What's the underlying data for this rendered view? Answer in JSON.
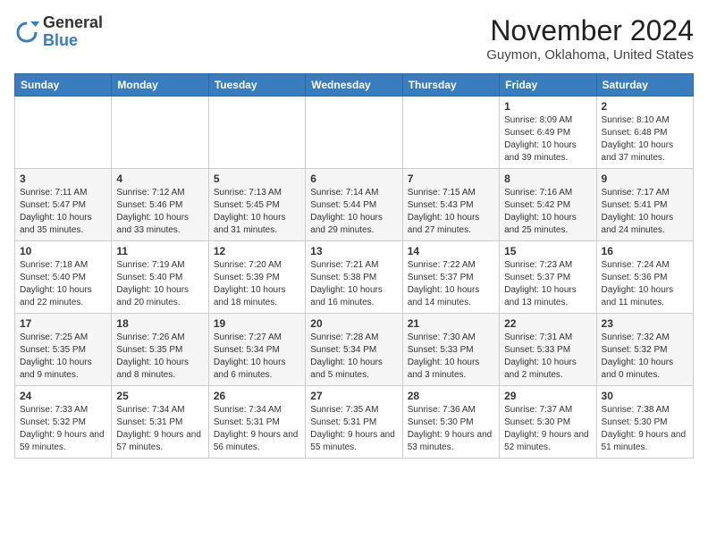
{
  "header": {
    "logo_line1": "General",
    "logo_line2": "Blue",
    "month": "November 2024",
    "location": "Guymon, Oklahoma, United States"
  },
  "weekdays": [
    "Sunday",
    "Monday",
    "Tuesday",
    "Wednesday",
    "Thursday",
    "Friday",
    "Saturday"
  ],
  "weeks": [
    [
      {
        "day": "",
        "info": ""
      },
      {
        "day": "",
        "info": ""
      },
      {
        "day": "",
        "info": ""
      },
      {
        "day": "",
        "info": ""
      },
      {
        "day": "",
        "info": ""
      },
      {
        "day": "1",
        "info": "Sunrise: 8:09 AM\nSunset: 6:49 PM\nDaylight: 10 hours and 39 minutes."
      },
      {
        "day": "2",
        "info": "Sunrise: 8:10 AM\nSunset: 6:48 PM\nDaylight: 10 hours and 37 minutes."
      }
    ],
    [
      {
        "day": "3",
        "info": "Sunrise: 7:11 AM\nSunset: 5:47 PM\nDaylight: 10 hours and 35 minutes."
      },
      {
        "day": "4",
        "info": "Sunrise: 7:12 AM\nSunset: 5:46 PM\nDaylight: 10 hours and 33 minutes."
      },
      {
        "day": "5",
        "info": "Sunrise: 7:13 AM\nSunset: 5:45 PM\nDaylight: 10 hours and 31 minutes."
      },
      {
        "day": "6",
        "info": "Sunrise: 7:14 AM\nSunset: 5:44 PM\nDaylight: 10 hours and 29 minutes."
      },
      {
        "day": "7",
        "info": "Sunrise: 7:15 AM\nSunset: 5:43 PM\nDaylight: 10 hours and 27 minutes."
      },
      {
        "day": "8",
        "info": "Sunrise: 7:16 AM\nSunset: 5:42 PM\nDaylight: 10 hours and 25 minutes."
      },
      {
        "day": "9",
        "info": "Sunrise: 7:17 AM\nSunset: 5:41 PM\nDaylight: 10 hours and 24 minutes."
      }
    ],
    [
      {
        "day": "10",
        "info": "Sunrise: 7:18 AM\nSunset: 5:40 PM\nDaylight: 10 hours and 22 minutes."
      },
      {
        "day": "11",
        "info": "Sunrise: 7:19 AM\nSunset: 5:40 PM\nDaylight: 10 hours and 20 minutes."
      },
      {
        "day": "12",
        "info": "Sunrise: 7:20 AM\nSunset: 5:39 PM\nDaylight: 10 hours and 18 minutes."
      },
      {
        "day": "13",
        "info": "Sunrise: 7:21 AM\nSunset: 5:38 PM\nDaylight: 10 hours and 16 minutes."
      },
      {
        "day": "14",
        "info": "Sunrise: 7:22 AM\nSunset: 5:37 PM\nDaylight: 10 hours and 14 minutes."
      },
      {
        "day": "15",
        "info": "Sunrise: 7:23 AM\nSunset: 5:37 PM\nDaylight: 10 hours and 13 minutes."
      },
      {
        "day": "16",
        "info": "Sunrise: 7:24 AM\nSunset: 5:36 PM\nDaylight: 10 hours and 11 minutes."
      }
    ],
    [
      {
        "day": "17",
        "info": "Sunrise: 7:25 AM\nSunset: 5:35 PM\nDaylight: 10 hours and 9 minutes."
      },
      {
        "day": "18",
        "info": "Sunrise: 7:26 AM\nSunset: 5:35 PM\nDaylight: 10 hours and 8 minutes."
      },
      {
        "day": "19",
        "info": "Sunrise: 7:27 AM\nSunset: 5:34 PM\nDaylight: 10 hours and 6 minutes."
      },
      {
        "day": "20",
        "info": "Sunrise: 7:28 AM\nSunset: 5:34 PM\nDaylight: 10 hours and 5 minutes."
      },
      {
        "day": "21",
        "info": "Sunrise: 7:30 AM\nSunset: 5:33 PM\nDaylight: 10 hours and 3 minutes."
      },
      {
        "day": "22",
        "info": "Sunrise: 7:31 AM\nSunset: 5:33 PM\nDaylight: 10 hours and 2 minutes."
      },
      {
        "day": "23",
        "info": "Sunrise: 7:32 AM\nSunset: 5:32 PM\nDaylight: 10 hours and 0 minutes."
      }
    ],
    [
      {
        "day": "24",
        "info": "Sunrise: 7:33 AM\nSunset: 5:32 PM\nDaylight: 9 hours and 59 minutes."
      },
      {
        "day": "25",
        "info": "Sunrise: 7:34 AM\nSunset: 5:31 PM\nDaylight: 9 hours and 57 minutes."
      },
      {
        "day": "26",
        "info": "Sunrise: 7:34 AM\nSunset: 5:31 PM\nDaylight: 9 hours and 56 minutes."
      },
      {
        "day": "27",
        "info": "Sunrise: 7:35 AM\nSunset: 5:31 PM\nDaylight: 9 hours and 55 minutes."
      },
      {
        "day": "28",
        "info": "Sunrise: 7:36 AM\nSunset: 5:30 PM\nDaylight: 9 hours and 53 minutes."
      },
      {
        "day": "29",
        "info": "Sunrise: 7:37 AM\nSunset: 5:30 PM\nDaylight: 9 hours and 52 minutes."
      },
      {
        "day": "30",
        "info": "Sunrise: 7:38 AM\nSunset: 5:30 PM\nDaylight: 9 hours and 51 minutes."
      }
    ]
  ]
}
